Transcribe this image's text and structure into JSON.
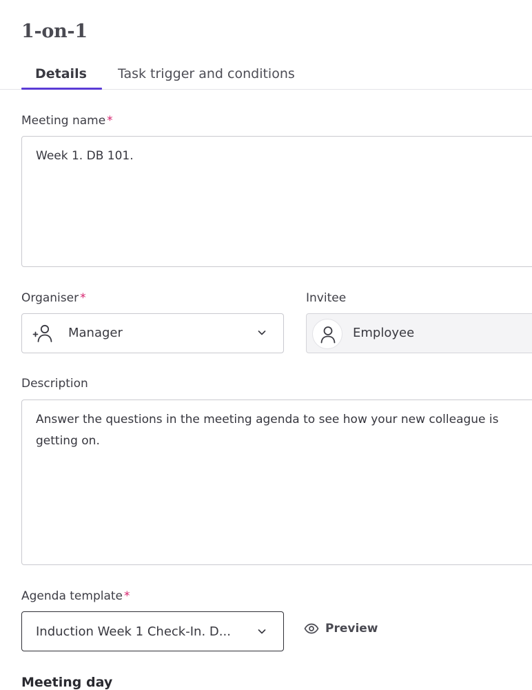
{
  "page": {
    "title": "1-on-1"
  },
  "tabs": [
    {
      "label": "Details",
      "active": true
    },
    {
      "label": "Task trigger and conditions",
      "active": false
    }
  ],
  "meeting_name": {
    "label": "Meeting name",
    "required_mark": "*",
    "value": "Week 1. DB 101."
  },
  "organiser": {
    "label": "Organiser",
    "required_mark": "*",
    "value": "Manager",
    "icon": "add-person-icon"
  },
  "invitee": {
    "label": "Invitee",
    "value": "Employee",
    "icon": "person-icon"
  },
  "description": {
    "label": "Description",
    "value": "Answer the questions in the meeting agenda to see how your new colleague is getting on."
  },
  "agenda_template": {
    "label": "Agenda template",
    "required_mark": "*",
    "value": "Induction Week 1 Check-In. D...",
    "preview_label": "Preview",
    "preview_icon": "eye-icon"
  },
  "meeting_day": {
    "label": "Meeting day"
  },
  "colors": {
    "accent": "#5b3bd6",
    "required": "#d6246e"
  }
}
